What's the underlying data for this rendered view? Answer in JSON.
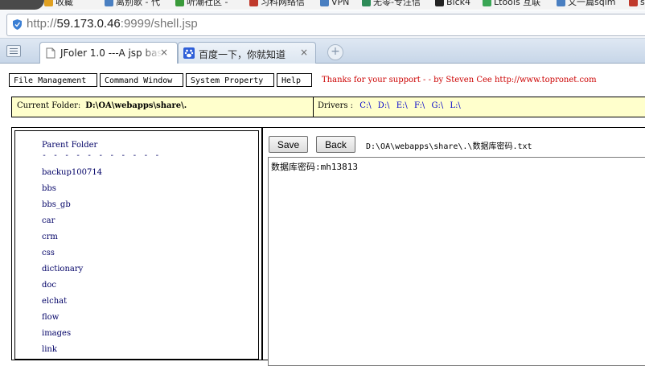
{
  "bookmarks": [
    {
      "label": "收藏",
      "icon": "favorites-icon",
      "color": "#e0a020"
    },
    {
      "label": "离别歌 - 代",
      "icon": "page-icon",
      "color": "#4a7fc1"
    },
    {
      "label": "听潮社区 -",
      "icon": "page-icon",
      "color": "#3a9a3a"
    },
    {
      "label": "习科网络信",
      "icon": "page-icon",
      "color": "#c0392b"
    },
    {
      "label": "VPN",
      "icon": "page-icon",
      "color": "#4a7fc1"
    },
    {
      "label": "无零-专注信",
      "icon": "x-icon",
      "color": "#2e8b57"
    },
    {
      "label": "Blck4",
      "icon": "github-icon",
      "color": "#222222"
    },
    {
      "label": "Ltools 互联",
      "icon": "page-icon",
      "color": "#3aa655"
    },
    {
      "label": "又一篇sqlm",
      "icon": "page-icon",
      "color": "#4a7fc1"
    },
    {
      "label": "s",
      "icon": "page-icon",
      "color": "#c0392b"
    }
  ],
  "address": {
    "scheme": "http://",
    "host": "59.173.0.46",
    "path": ":9999/shell.jsp"
  },
  "tabs": [
    {
      "label": "JFoler 1.0 ---A jsp bas",
      "active": true
    },
    {
      "label": "百度一下，你就知道",
      "active": false
    }
  ],
  "close_glyph": "×",
  "newtab_glyph": "+",
  "menu": [
    "File Management",
    "Command Window",
    "System Property",
    "Help"
  ],
  "thanks": "Thanks for your support - - by Steven Cee http://www.topronet.com",
  "current_folder": {
    "label": "Current Folder:",
    "path": "D:\\OA\\webapps\\share\\."
  },
  "drivers": {
    "label": "Drivers :",
    "list": [
      "C:\\",
      "D:\\",
      "E:\\",
      "F:\\",
      "G:\\",
      "L:\\"
    ]
  },
  "left": {
    "parent_label": "Parent Folder",
    "dashes": "- - - - - - - - - - -",
    "folders": [
      "backup100714",
      "bbs",
      "bbs_gb",
      "car",
      "crm",
      "css",
      "dictionary",
      "doc",
      "elchat",
      "flow",
      "images",
      "link"
    ]
  },
  "editor": {
    "save_label": "Save",
    "back_label": "Back",
    "file_path": "D:\\OA\\webapps\\share\\.\\数据库密码.txt",
    "content": "数据库密码:mh13813"
  }
}
